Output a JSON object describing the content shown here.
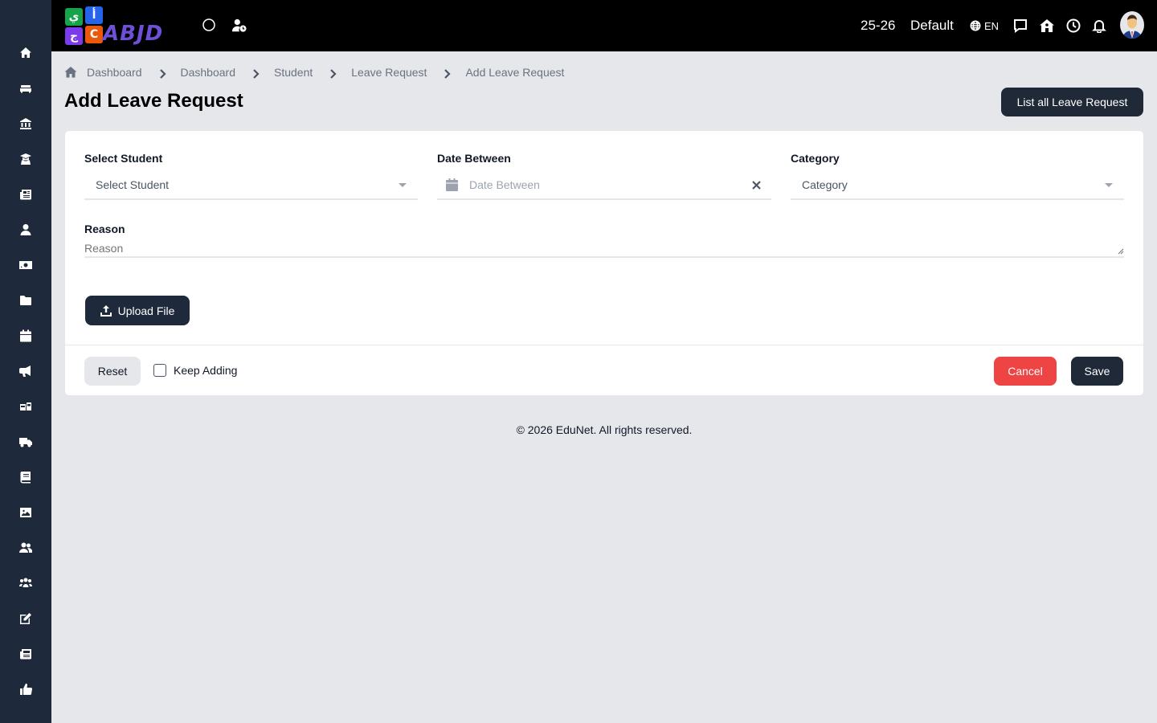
{
  "sidebar": {
    "items": [
      {
        "icon": "home-icon"
      },
      {
        "icon": "sofa-icon"
      },
      {
        "icon": "institution-icon"
      },
      {
        "icon": "graduate-icon"
      },
      {
        "icon": "newspaper-icon"
      },
      {
        "icon": "user-icon"
      },
      {
        "icon": "money-icon"
      },
      {
        "icon": "folder-icon"
      },
      {
        "icon": "calendar-icon"
      },
      {
        "icon": "megaphone-icon"
      },
      {
        "icon": "school-bus-icon"
      },
      {
        "icon": "truck-icon"
      },
      {
        "icon": "book-icon"
      },
      {
        "icon": "image-icon"
      },
      {
        "icon": "users-icon"
      },
      {
        "icon": "group-icon"
      },
      {
        "icon": "edit-icon"
      },
      {
        "icon": "news-icon"
      },
      {
        "icon": "thumbs-up-icon"
      }
    ]
  },
  "topbar": {
    "logo_tiles": [
      "ي",
      "أ",
      "ج",
      "C"
    ],
    "logo_word": "ABJD",
    "session": "25-26",
    "profile": "Default",
    "language": "EN"
  },
  "breadcrumb": {
    "items": [
      "Dashboard",
      "Dashboard",
      "Student",
      "Leave Request",
      "Add Leave Request"
    ]
  },
  "page": {
    "title": "Add Leave Request",
    "list_button": "List all Leave Request"
  },
  "form": {
    "student_label": "Select Student",
    "student_value": "Select Student",
    "date_label": "Date Between",
    "date_placeholder": "Date Between",
    "category_label": "Category",
    "category_value": "Category",
    "reason_label": "Reason",
    "reason_placeholder": "Reason",
    "upload_label": "Upload File",
    "reset_label": "Reset",
    "keep_adding_label": "Keep Adding",
    "keep_adding_checked": false,
    "cancel_label": "Cancel",
    "save_label": "Save"
  },
  "footer": {
    "text": "© 2026 EduNet. All rights reserved."
  },
  "colors": {
    "sidebar": "#1e293b",
    "topbar": "#000000",
    "background": "#e5e7eb",
    "primary_button": "#1f2937",
    "cancel_button": "#ef4444",
    "logo_green": "#16a34a",
    "logo_blue": "#2563eb",
    "logo_purple": "#7c3aed",
    "logo_orange": "#ea580c"
  }
}
